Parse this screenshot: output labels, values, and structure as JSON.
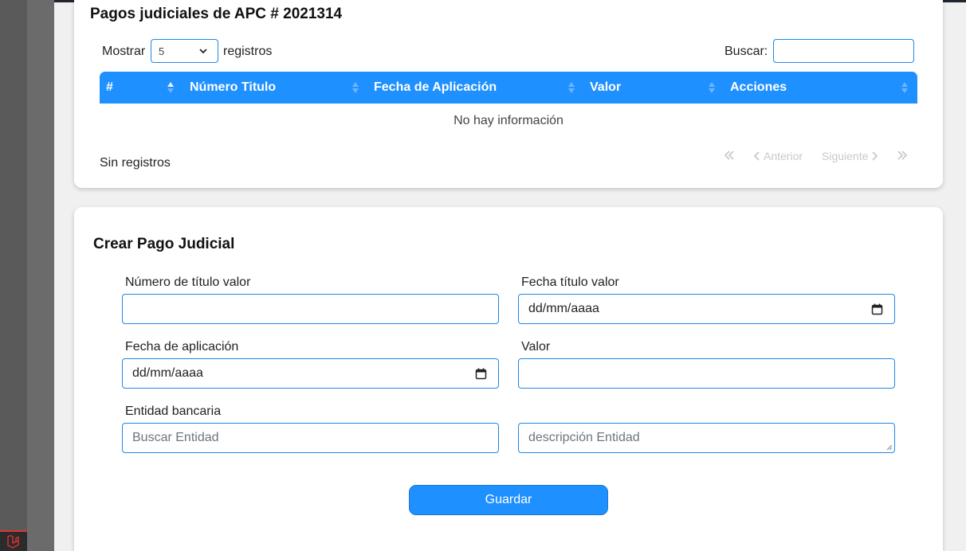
{
  "payments_card": {
    "title": "Pagos judiciales de APC # 2021314",
    "show_label": "Mostrar",
    "page_size": "5",
    "records_label": "registros",
    "search_label": "Buscar:",
    "columns": [
      "#",
      "Número Titulo",
      "Fecha de Aplicación",
      "Valor",
      "Acciones"
    ],
    "empty_message": "No hay información",
    "footer_status": "Sin registros",
    "pagination": {
      "prev_label": "Anterior",
      "next_label": "Siguiente"
    }
  },
  "create_card": {
    "title": "Crear Pago Judicial",
    "fields": {
      "numero_label": "Número de título valor",
      "fecha_titulo_label": "Fecha título valor",
      "fecha_titulo_value": "dd/mm/aaaa",
      "fecha_aplicacion_label": "Fecha de aplicación",
      "fecha_aplicacion_value": "dd/mm/aaaa",
      "valor_label": "Valor",
      "entidad_label": "Entidad bancaria",
      "entidad_placeholder": "Buscar Entidad",
      "descripcion_placeholder": "descripción Entidad"
    },
    "save_label": "Guardar"
  },
  "colors": {
    "primary": "#1e90ff",
    "border": "#1e88e5",
    "backdrop": "#616161"
  }
}
